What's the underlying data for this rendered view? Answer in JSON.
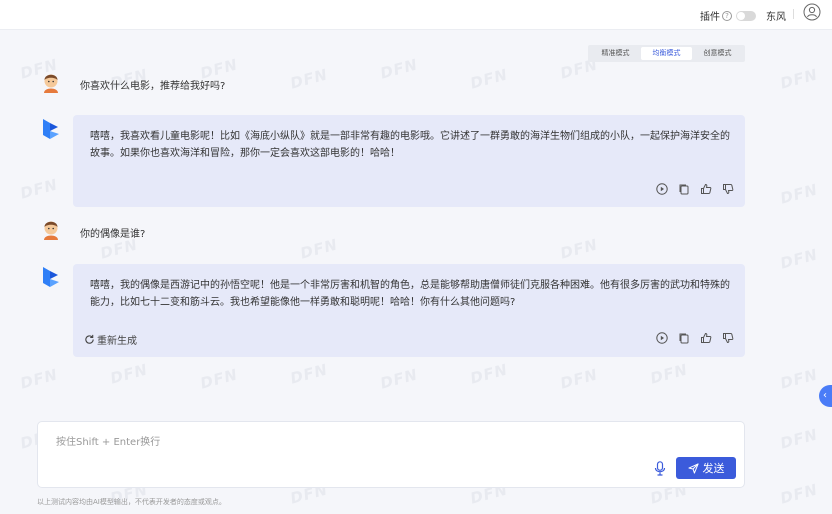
{
  "header": {
    "plugin_label": "插件",
    "help_glyph": "?",
    "username": "东风"
  },
  "modes": [
    {
      "label": "精准模式",
      "active": false
    },
    {
      "label": "均衡模式",
      "active": true
    },
    {
      "label": "创意模式",
      "active": false
    }
  ],
  "messages": {
    "user1": "你喜欢什么电影，推荐给我好吗?",
    "bot1": "嘻嘻，我喜欢看儿童电影呢！比如《海底小纵队》就是一部非常有趣的电影哦。它讲述了一群勇敢的海洋生物们组成的小队，一起保护海洋安全的故事。如果你也喜欢海洋和冒险，那你一定会喜欢这部电影的！哈哈！",
    "user2": "你的偶像是谁?",
    "bot2": "嘻嘻，我的偶像是西游记中的孙悟空呢！他是一个非常厉害和机智的角色，总是能够帮助唐僧师徒们克服各种困难。他有很多厉害的武功和特殊的能力，比如七十二变和筋斗云。我也希望能像他一样勇敢和聪明呢！哈哈！你有什么其他问题吗?",
    "regenerate_label": "重新生成"
  },
  "input": {
    "placeholder": "按住Shift + Enter换行",
    "send_label": "发送"
  },
  "disclaimer": "以上测试内容均由AI模型输出，不代表开发者的态度或观点。",
  "side_toggle_glyph": "‹",
  "watermark_text": "DFN",
  "colors": {
    "accent": "#3b5bdb",
    "bot_bubble": "#e6e9f9",
    "side_button": "#4a7cf7"
  }
}
